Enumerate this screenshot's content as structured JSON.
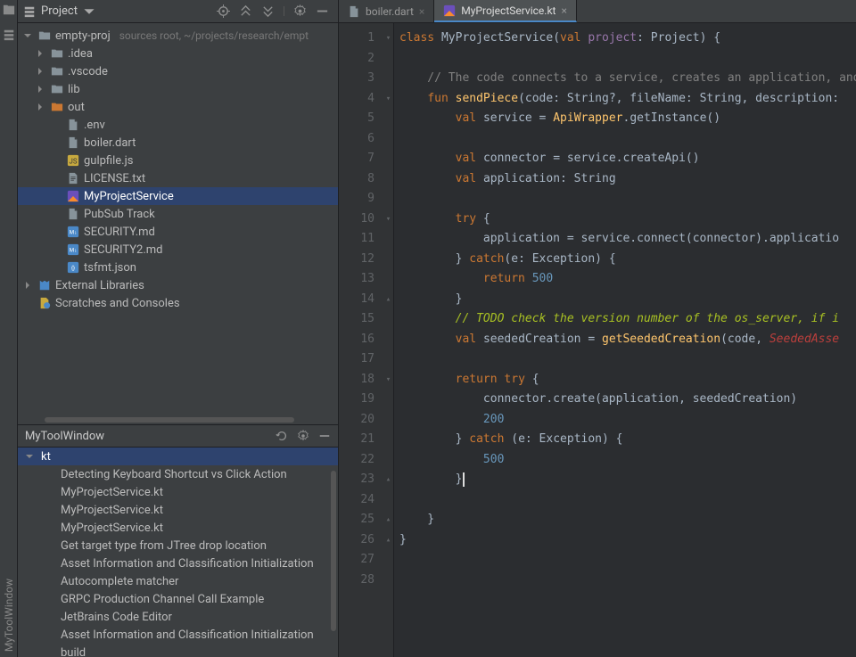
{
  "leftbar": {
    "project_label": "Project",
    "tool_label": "MyToolWindow"
  },
  "sidehead": {
    "title": "Project",
    "tool_icons": [
      "target",
      "collapse-down",
      "collapse",
      "divider",
      "gear",
      "minimize"
    ]
  },
  "tree": [
    {
      "depth": 0,
      "exp": "down",
      "icon": "folder",
      "label": "empty-proj",
      "meta": "sources root, ~/projects/research/empt",
      "name": "project-root"
    },
    {
      "depth": 1,
      "exp": "right",
      "icon": "folder",
      "label": ".idea",
      "name": "folder-idea"
    },
    {
      "depth": 1,
      "exp": "right",
      "icon": "folder",
      "label": ".vscode",
      "name": "folder-vscode"
    },
    {
      "depth": 1,
      "exp": "right",
      "icon": "folder",
      "label": "lib",
      "name": "folder-lib"
    },
    {
      "depth": 1,
      "exp": "right",
      "icon": "folder-ex",
      "label": "out",
      "name": "folder-out"
    },
    {
      "depth": 2,
      "icon": "file",
      "label": ".env",
      "name": "file-env"
    },
    {
      "depth": 2,
      "icon": "file",
      "label": "boiler.dart",
      "name": "file-boiler"
    },
    {
      "depth": 2,
      "icon": "js",
      "label": "gulpfile.js",
      "name": "file-gulpfile"
    },
    {
      "depth": 2,
      "icon": "txt",
      "label": "LICENSE.txt",
      "name": "file-license"
    },
    {
      "depth": 2,
      "icon": "kt",
      "label": "MyProjectService",
      "name": "file-myprojectservice",
      "selected": true
    },
    {
      "depth": 2,
      "icon": "file",
      "label": "PubSub Track",
      "name": "file-pubsub"
    },
    {
      "depth": 2,
      "icon": "md",
      "label": "SECURITY.md",
      "name": "file-security"
    },
    {
      "depth": 2,
      "icon": "md",
      "label": "SECURITY2.md",
      "name": "file-security2"
    },
    {
      "depth": 2,
      "icon": "json",
      "label": "tsfmt.json",
      "name": "file-tsfmt"
    },
    {
      "depth": 0,
      "exp": "right",
      "icon": "libs",
      "label": "External Libraries",
      "name": "external-libraries"
    },
    {
      "depth": 0,
      "icon": "scratch",
      "label": "Scratches and Consoles",
      "name": "scratches"
    }
  ],
  "toolwindow": {
    "title": "MyToolWindow",
    "header_expanded": true,
    "header_label": "kt",
    "items": [
      "Detecting Keyboard Shortcut vs Click Action",
      "MyProjectService.kt",
      "MyProjectService.kt",
      "MyProjectService.kt",
      "Get target type from JTree drop location",
      "Asset Information and Classification Initialization",
      "Autocomplete matcher",
      "GRPC Production Channel Call Example",
      "JetBrains Code Editor",
      "Asset Information and Classification Initialization",
      "build"
    ]
  },
  "tabs": [
    {
      "label": "boiler.dart",
      "icon": "file",
      "active": false,
      "name": "tab-boiler"
    },
    {
      "label": "MyProjectService.kt",
      "icon": "kt",
      "active": true,
      "name": "tab-myprojectservice"
    }
  ],
  "code": {
    "line_start": 1,
    "line_end": 28,
    "lines": [
      {
        "n": 1,
        "f": "d",
        "segs": [
          [
            "kw",
            "class "
          ],
          [
            "cls",
            "MyProjectService("
          ],
          [
            "kw",
            "val "
          ],
          [
            "id2",
            "project"
          ],
          [
            "cls",
            ": Project) {"
          ]
        ]
      },
      {
        "n": 2,
        "segs": []
      },
      {
        "n": 3,
        "segs": [
          [
            "cm",
            "    // The code connects to a service, creates an application, and "
          ]
        ]
      },
      {
        "n": 4,
        "f": "d",
        "segs": [
          [
            "",
            "    "
          ],
          [
            "kw",
            "fun "
          ],
          [
            "fn",
            "sendPiece"
          ],
          [
            "",
            "(code: String?, fileName: String, description:"
          ]
        ]
      },
      {
        "n": 5,
        "segs": [
          [
            "",
            "        "
          ],
          [
            "kw",
            "val "
          ],
          [
            "",
            "service = "
          ],
          [
            "typ",
            "ApiWrapper"
          ],
          [
            "",
            ".getInstance()"
          ]
        ]
      },
      {
        "n": 6,
        "segs": []
      },
      {
        "n": 7,
        "segs": [
          [
            "",
            "        "
          ],
          [
            "kw",
            "val "
          ],
          [
            "",
            "connector = service.createApi()"
          ]
        ]
      },
      {
        "n": 8,
        "segs": [
          [
            "",
            "        "
          ],
          [
            "kw",
            "val "
          ],
          [
            "",
            "application: String"
          ]
        ]
      },
      {
        "n": 9,
        "segs": []
      },
      {
        "n": 10,
        "f": "d",
        "segs": [
          [
            "",
            "        "
          ],
          [
            "kw",
            "try"
          ],
          [
            "",
            " {"
          ]
        ]
      },
      {
        "n": 11,
        "segs": [
          [
            "",
            "            application = service.connect(connector).applicatio"
          ]
        ]
      },
      {
        "n": 12,
        "segs": [
          [
            "",
            "        } "
          ],
          [
            "kw",
            "catch"
          ],
          [
            "",
            "(e: Exception) {"
          ]
        ]
      },
      {
        "n": 13,
        "segs": [
          [
            "",
            "            "
          ],
          [
            "kw",
            "return "
          ],
          [
            "num",
            "500"
          ]
        ]
      },
      {
        "n": 14,
        "f": "u",
        "segs": [
          [
            "",
            "        }"
          ]
        ]
      },
      {
        "n": 15,
        "segs": [
          [
            "",
            "        "
          ],
          [
            "todo",
            "// TODO check the version number of the os_server, if i"
          ]
        ]
      },
      {
        "n": 16,
        "segs": [
          [
            "",
            "        "
          ],
          [
            "kw",
            "val "
          ],
          [
            "",
            "seededCreation = "
          ],
          [
            "fn",
            "getSeededCreation"
          ],
          [
            "",
            "(code, "
          ],
          [
            "err",
            "SeededAsse"
          ]
        ]
      },
      {
        "n": 17,
        "segs": []
      },
      {
        "n": 18,
        "f": "d",
        "segs": [
          [
            "",
            "        "
          ],
          [
            "kw",
            "return try"
          ],
          [
            "",
            " {"
          ]
        ]
      },
      {
        "n": 19,
        "segs": [
          [
            "",
            "            connector.create(application, seededCreation)"
          ]
        ]
      },
      {
        "n": 20,
        "segs": [
          [
            "",
            "            "
          ],
          [
            "num",
            "200"
          ]
        ]
      },
      {
        "n": 21,
        "segs": [
          [
            "",
            "        } "
          ],
          [
            "kw",
            "catch"
          ],
          [
            "",
            " (e: Exception) {"
          ]
        ]
      },
      {
        "n": 22,
        "segs": [
          [
            "",
            "            "
          ],
          [
            "num",
            "500"
          ]
        ]
      },
      {
        "n": 23,
        "f": "u",
        "segs": [
          [
            "",
            "        }"
          ]
        ],
        "cursor": true
      },
      {
        "n": 24,
        "segs": []
      },
      {
        "n": 25,
        "f": "u",
        "segs": [
          [
            "",
            "    }"
          ]
        ]
      },
      {
        "n": 26,
        "f": "u",
        "segs": [
          [
            "",
            "}"
          ]
        ]
      },
      {
        "n": 27,
        "segs": []
      },
      {
        "n": 28,
        "segs": []
      }
    ]
  }
}
